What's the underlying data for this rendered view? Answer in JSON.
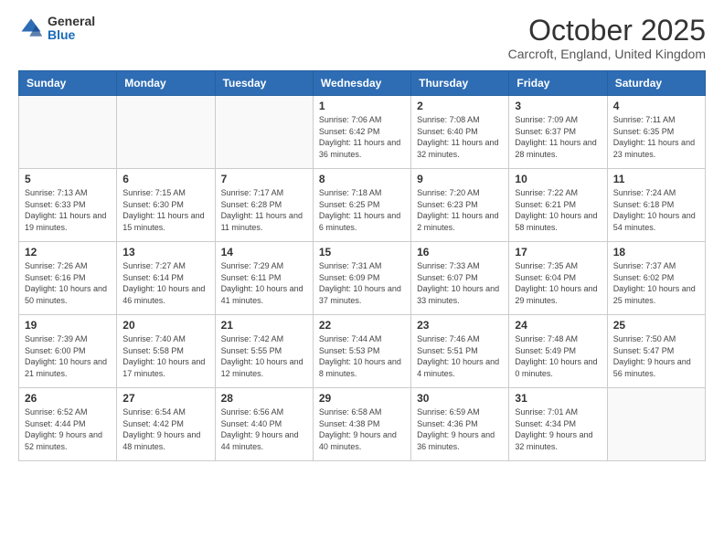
{
  "header": {
    "logo_general": "General",
    "logo_blue": "Blue",
    "month_title": "October 2025",
    "location": "Carcroft, England, United Kingdom"
  },
  "days_of_week": [
    "Sunday",
    "Monday",
    "Tuesday",
    "Wednesday",
    "Thursday",
    "Friday",
    "Saturday"
  ],
  "weeks": [
    [
      {
        "day": "",
        "sunrise": "",
        "sunset": "",
        "daylight": ""
      },
      {
        "day": "",
        "sunrise": "",
        "sunset": "",
        "daylight": ""
      },
      {
        "day": "",
        "sunrise": "",
        "sunset": "",
        "daylight": ""
      },
      {
        "day": "1",
        "sunrise": "Sunrise: 7:06 AM",
        "sunset": "Sunset: 6:42 PM",
        "daylight": "Daylight: 11 hours and 36 minutes."
      },
      {
        "day": "2",
        "sunrise": "Sunrise: 7:08 AM",
        "sunset": "Sunset: 6:40 PM",
        "daylight": "Daylight: 11 hours and 32 minutes."
      },
      {
        "day": "3",
        "sunrise": "Sunrise: 7:09 AM",
        "sunset": "Sunset: 6:37 PM",
        "daylight": "Daylight: 11 hours and 28 minutes."
      },
      {
        "day": "4",
        "sunrise": "Sunrise: 7:11 AM",
        "sunset": "Sunset: 6:35 PM",
        "daylight": "Daylight: 11 hours and 23 minutes."
      }
    ],
    [
      {
        "day": "5",
        "sunrise": "Sunrise: 7:13 AM",
        "sunset": "Sunset: 6:33 PM",
        "daylight": "Daylight: 11 hours and 19 minutes."
      },
      {
        "day": "6",
        "sunrise": "Sunrise: 7:15 AM",
        "sunset": "Sunset: 6:30 PM",
        "daylight": "Daylight: 11 hours and 15 minutes."
      },
      {
        "day": "7",
        "sunrise": "Sunrise: 7:17 AM",
        "sunset": "Sunset: 6:28 PM",
        "daylight": "Daylight: 11 hours and 11 minutes."
      },
      {
        "day": "8",
        "sunrise": "Sunrise: 7:18 AM",
        "sunset": "Sunset: 6:25 PM",
        "daylight": "Daylight: 11 hours and 6 minutes."
      },
      {
        "day": "9",
        "sunrise": "Sunrise: 7:20 AM",
        "sunset": "Sunset: 6:23 PM",
        "daylight": "Daylight: 11 hours and 2 minutes."
      },
      {
        "day": "10",
        "sunrise": "Sunrise: 7:22 AM",
        "sunset": "Sunset: 6:21 PM",
        "daylight": "Daylight: 10 hours and 58 minutes."
      },
      {
        "day": "11",
        "sunrise": "Sunrise: 7:24 AM",
        "sunset": "Sunset: 6:18 PM",
        "daylight": "Daylight: 10 hours and 54 minutes."
      }
    ],
    [
      {
        "day": "12",
        "sunrise": "Sunrise: 7:26 AM",
        "sunset": "Sunset: 6:16 PM",
        "daylight": "Daylight: 10 hours and 50 minutes."
      },
      {
        "day": "13",
        "sunrise": "Sunrise: 7:27 AM",
        "sunset": "Sunset: 6:14 PM",
        "daylight": "Daylight: 10 hours and 46 minutes."
      },
      {
        "day": "14",
        "sunrise": "Sunrise: 7:29 AM",
        "sunset": "Sunset: 6:11 PM",
        "daylight": "Daylight: 10 hours and 41 minutes."
      },
      {
        "day": "15",
        "sunrise": "Sunrise: 7:31 AM",
        "sunset": "Sunset: 6:09 PM",
        "daylight": "Daylight: 10 hours and 37 minutes."
      },
      {
        "day": "16",
        "sunrise": "Sunrise: 7:33 AM",
        "sunset": "Sunset: 6:07 PM",
        "daylight": "Daylight: 10 hours and 33 minutes."
      },
      {
        "day": "17",
        "sunrise": "Sunrise: 7:35 AM",
        "sunset": "Sunset: 6:04 PM",
        "daylight": "Daylight: 10 hours and 29 minutes."
      },
      {
        "day": "18",
        "sunrise": "Sunrise: 7:37 AM",
        "sunset": "Sunset: 6:02 PM",
        "daylight": "Daylight: 10 hours and 25 minutes."
      }
    ],
    [
      {
        "day": "19",
        "sunrise": "Sunrise: 7:39 AM",
        "sunset": "Sunset: 6:00 PM",
        "daylight": "Daylight: 10 hours and 21 minutes."
      },
      {
        "day": "20",
        "sunrise": "Sunrise: 7:40 AM",
        "sunset": "Sunset: 5:58 PM",
        "daylight": "Daylight: 10 hours and 17 minutes."
      },
      {
        "day": "21",
        "sunrise": "Sunrise: 7:42 AM",
        "sunset": "Sunset: 5:55 PM",
        "daylight": "Daylight: 10 hours and 12 minutes."
      },
      {
        "day": "22",
        "sunrise": "Sunrise: 7:44 AM",
        "sunset": "Sunset: 5:53 PM",
        "daylight": "Daylight: 10 hours and 8 minutes."
      },
      {
        "day": "23",
        "sunrise": "Sunrise: 7:46 AM",
        "sunset": "Sunset: 5:51 PM",
        "daylight": "Daylight: 10 hours and 4 minutes."
      },
      {
        "day": "24",
        "sunrise": "Sunrise: 7:48 AM",
        "sunset": "Sunset: 5:49 PM",
        "daylight": "Daylight: 10 hours and 0 minutes."
      },
      {
        "day": "25",
        "sunrise": "Sunrise: 7:50 AM",
        "sunset": "Sunset: 5:47 PM",
        "daylight": "Daylight: 9 hours and 56 minutes."
      }
    ],
    [
      {
        "day": "26",
        "sunrise": "Sunrise: 6:52 AM",
        "sunset": "Sunset: 4:44 PM",
        "daylight": "Daylight: 9 hours and 52 minutes."
      },
      {
        "day": "27",
        "sunrise": "Sunrise: 6:54 AM",
        "sunset": "Sunset: 4:42 PM",
        "daylight": "Daylight: 9 hours and 48 minutes."
      },
      {
        "day": "28",
        "sunrise": "Sunrise: 6:56 AM",
        "sunset": "Sunset: 4:40 PM",
        "daylight": "Daylight: 9 hours and 44 minutes."
      },
      {
        "day": "29",
        "sunrise": "Sunrise: 6:58 AM",
        "sunset": "Sunset: 4:38 PM",
        "daylight": "Daylight: 9 hours and 40 minutes."
      },
      {
        "day": "30",
        "sunrise": "Sunrise: 6:59 AM",
        "sunset": "Sunset: 4:36 PM",
        "daylight": "Daylight: 9 hours and 36 minutes."
      },
      {
        "day": "31",
        "sunrise": "Sunrise: 7:01 AM",
        "sunset": "Sunset: 4:34 PM",
        "daylight": "Daylight: 9 hours and 32 minutes."
      },
      {
        "day": "",
        "sunrise": "",
        "sunset": "",
        "daylight": ""
      }
    ]
  ]
}
